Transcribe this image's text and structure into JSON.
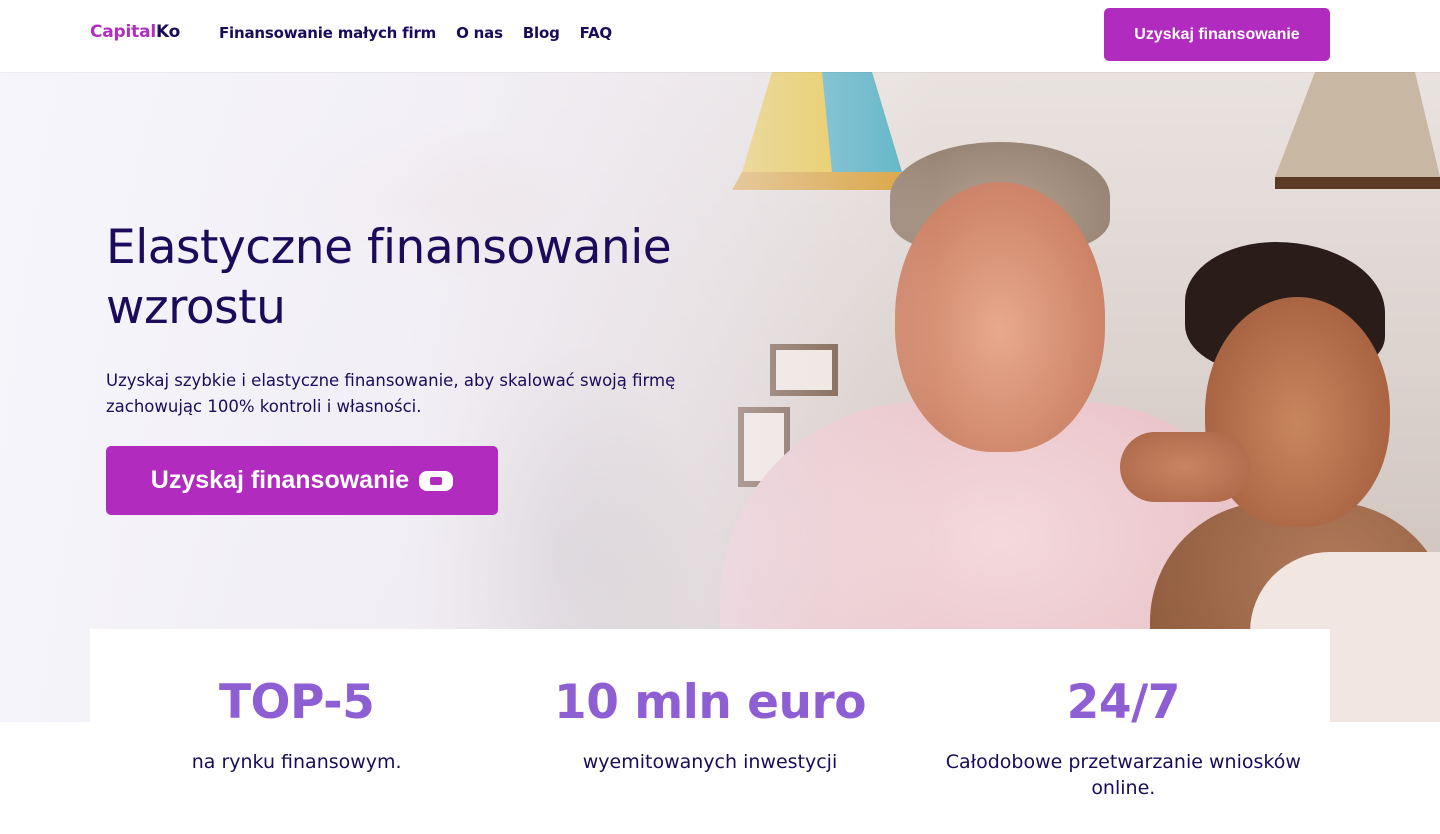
{
  "brand": {
    "logo_part1": "Capital",
    "logo_part2": "Ko"
  },
  "nav": {
    "items": [
      {
        "label": "Finansowanie małych firm"
      },
      {
        "label": "O nas"
      },
      {
        "label": "Blog"
      },
      {
        "label": "FAQ"
      }
    ],
    "cta_label": "Uzyskaj finansowanie"
  },
  "hero": {
    "title": "Elastyczne finansowanie wzrostu",
    "subtitle": "Uzyskaj szybkie i elastyczne finansowanie, aby skalować swoją firmę zachowując 100% kontroli i własności.",
    "cta_label": "Uzyskaj finansowanie",
    "cta_icon": "wallet-icon"
  },
  "stats": [
    {
      "value": "TOP-5",
      "label": "na rynku finansowym."
    },
    {
      "value": "10 mln euro",
      "label": "wyemitowanych inwestycji"
    },
    {
      "value": "24/7",
      "label": "Całodobowe przetwarzanie wniosków online."
    }
  ],
  "colors": {
    "accent": "#b12bbf",
    "navy": "#1b0b5a",
    "stat_purple": "#8e5fd3"
  }
}
